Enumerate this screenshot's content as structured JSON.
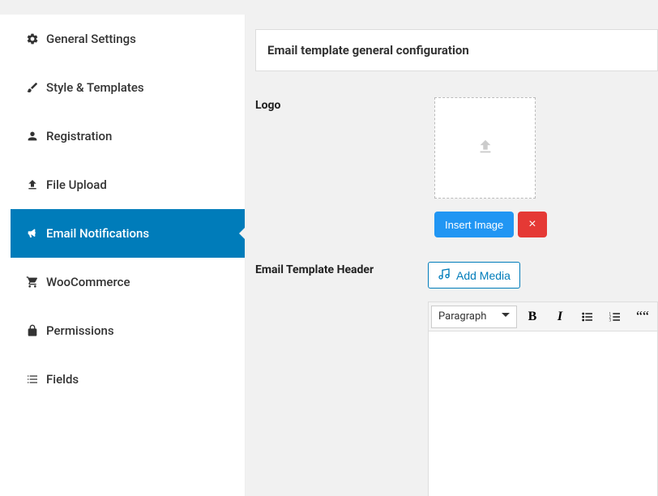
{
  "sidebar": {
    "items": [
      {
        "label": "General Settings"
      },
      {
        "label": "Style & Templates"
      },
      {
        "label": "Registration"
      },
      {
        "label": "File Upload"
      },
      {
        "label": "Email Notifications"
      },
      {
        "label": "WooCommerce"
      },
      {
        "label": "Permissions"
      },
      {
        "label": "Fields"
      }
    ]
  },
  "section": {
    "header": "Email template general configuration"
  },
  "form": {
    "logo_label": "Logo",
    "insert_image_label": "Insert Image",
    "remove_label": "×",
    "header_label": "Email Template Header",
    "add_media_label": "Add Media"
  },
  "editor": {
    "paragraph_label": "Paragraph",
    "bold_label": "B",
    "italic_label": "I",
    "quote_label": "““"
  }
}
